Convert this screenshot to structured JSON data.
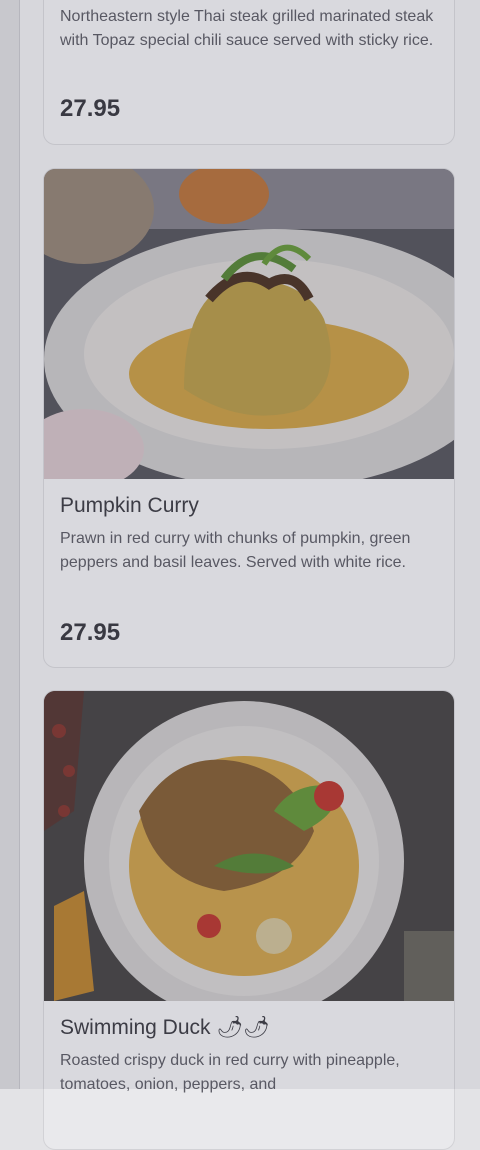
{
  "menu": {
    "items": [
      {
        "description": "Northeastern style Thai steak grilled marinated steak with Topaz special chili sauce served with sticky rice.",
        "price": "27.95"
      },
      {
        "name": "Pumpkin Curry",
        "description": "Prawn in red curry with chunks of pumpkin, green peppers and basil leaves. Served with white rice.",
        "price": "27.95",
        "image_icon": "pumpkin-curry-photo"
      },
      {
        "name": "Swimming Duck 🌶🌶",
        "description": "Roasted crispy duck in red curry with pineapple, tomatoes, onion, peppers, and",
        "image_icon": "swimming-duck-photo"
      }
    ]
  },
  "colors": {
    "background": "#e7e7ea",
    "card": "#e9e9ec",
    "text": "#3e3e46"
  }
}
